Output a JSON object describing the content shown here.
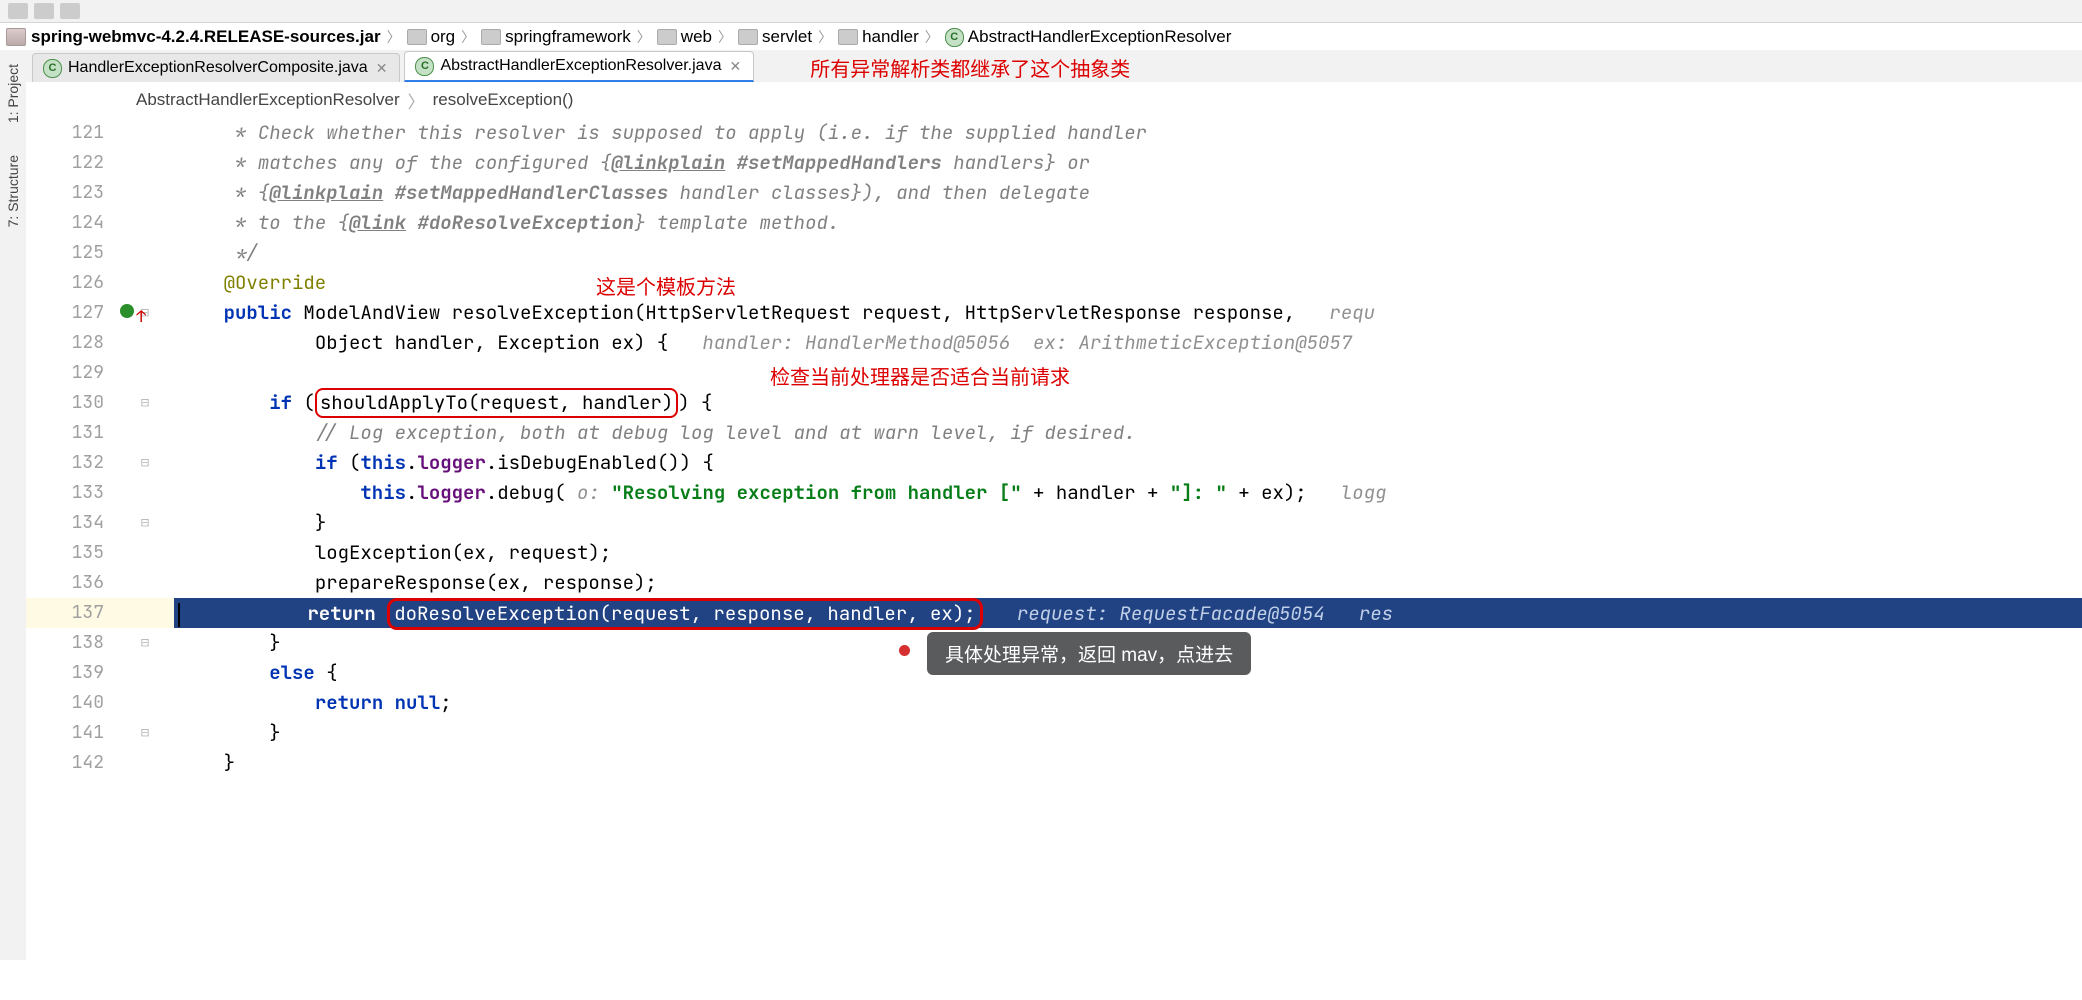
{
  "toolbar": {
    "icons": 12
  },
  "breadcrumb": {
    "jar": "spring-webmvc-4.2.4.RELEASE-sources.jar",
    "segments": [
      "org",
      "springframework",
      "web",
      "servlet",
      "handler"
    ],
    "class": "AbstractHandlerExceptionResolver"
  },
  "side_tabs": [
    {
      "label": "1: Project"
    },
    {
      "label": "7: Structure"
    }
  ],
  "editor_tabs": [
    {
      "file": "HandlerExceptionResolverComposite.java",
      "active": false
    },
    {
      "file": "AbstractHandlerExceptionResolver.java",
      "active": true
    }
  ],
  "tab_annotation": "所有异常解析类都继承了这个抽象类",
  "code_crumb": {
    "class": "AbstractHandlerExceptionResolver",
    "method": "resolveException()"
  },
  "annotations": {
    "template_method": "这是个模板方法",
    "check_handler": "检查当前处理器是否适合当前请求",
    "bubble": "具体处理异常，返回 mav，点进去"
  },
  "code": {
    "lines": [
      {
        "n": 121,
        "t": "doc",
        "txt": "* Check whether this resolver is supposed to apply (i.e. if the supplied handler"
      },
      {
        "n": 122,
        "t": "doc",
        "txt_pre": "* matches any of the configured {",
        "tag": "@linkplain",
        "tag_name": " #setMappedHandlers",
        "txt_post": " handlers} or"
      },
      {
        "n": 123,
        "t": "doc",
        "txt_pre": "* {",
        "tag": "@linkplain",
        "tag_name": " #setMappedHandlerClasses",
        "txt_post": " handler classes}), and then delegate"
      },
      {
        "n": 124,
        "t": "doc",
        "txt_pre": "* to the {",
        "tag": "@link",
        "tag_name": " #doResolveException",
        "txt_post": "} template method."
      },
      {
        "n": 125,
        "t": "doc",
        "txt": "*/"
      },
      {
        "n": 126,
        "t": "ann",
        "txt": "@Override"
      },
      {
        "n": 127,
        "t": "sig",
        "kw": "public",
        "rest": " ModelAndView resolveException(HttpServletRequest request, HttpServletResponse response,",
        "hint": "   requ",
        "icon": true
      },
      {
        "n": 128,
        "t": "sig2",
        "rest": "Object handler, Exception ex) {",
        "hint": "   handler: HandlerMethod@5056  ex: ArithmeticException@5057"
      },
      {
        "n": 129,
        "t": "blank"
      },
      {
        "n": 130,
        "t": "if1",
        "kw": "if",
        "box": "shouldApplyTo(request, handler)",
        "post": ") {"
      },
      {
        "n": 131,
        "t": "cmt",
        "txt": "// Log exception, both at debug log level and at warn level, if desired."
      },
      {
        "n": 132,
        "t": "if2",
        "kw": "if",
        "pre": " (",
        "f1": "this",
        "dot": ".",
        "f2": "logger",
        "rest": ".isDebugEnabled()) {"
      },
      {
        "n": 133,
        "t": "dbg",
        "f1": "this",
        "dot": ".",
        "f2": "logger",
        "rest1": ".debug(",
        "hint": " o: ",
        "str": "\"Resolving exception from handler [\"",
        "rest2": " + handler + ",
        "str2": "\"]: \"",
        "rest3": " + ex);",
        "tail": "   logg"
      },
      {
        "n": 134,
        "t": "close",
        "txt": "}"
      },
      {
        "n": 135,
        "t": "call",
        "txt": "logException(ex, request);"
      },
      {
        "n": 136,
        "t": "call",
        "txt": "prepareResponse(ex, response);"
      },
      {
        "n": 137,
        "t": "ret",
        "kw": "return",
        "box": "doResolveException(request, response, handler, ex);",
        "hint": "   request: RequestFacade@5054   res"
      },
      {
        "n": 138,
        "t": "close2",
        "txt": "}"
      },
      {
        "n": 139,
        "t": "else",
        "kw": "else",
        "post": " {"
      },
      {
        "n": 140,
        "t": "retnull",
        "kw": "return",
        "post": " ",
        "kw2": "null",
        "end": ";"
      },
      {
        "n": 141,
        "t": "close2",
        "txt": "}"
      },
      {
        "n": 142,
        "t": "close3",
        "txt": "}"
      }
    ]
  }
}
